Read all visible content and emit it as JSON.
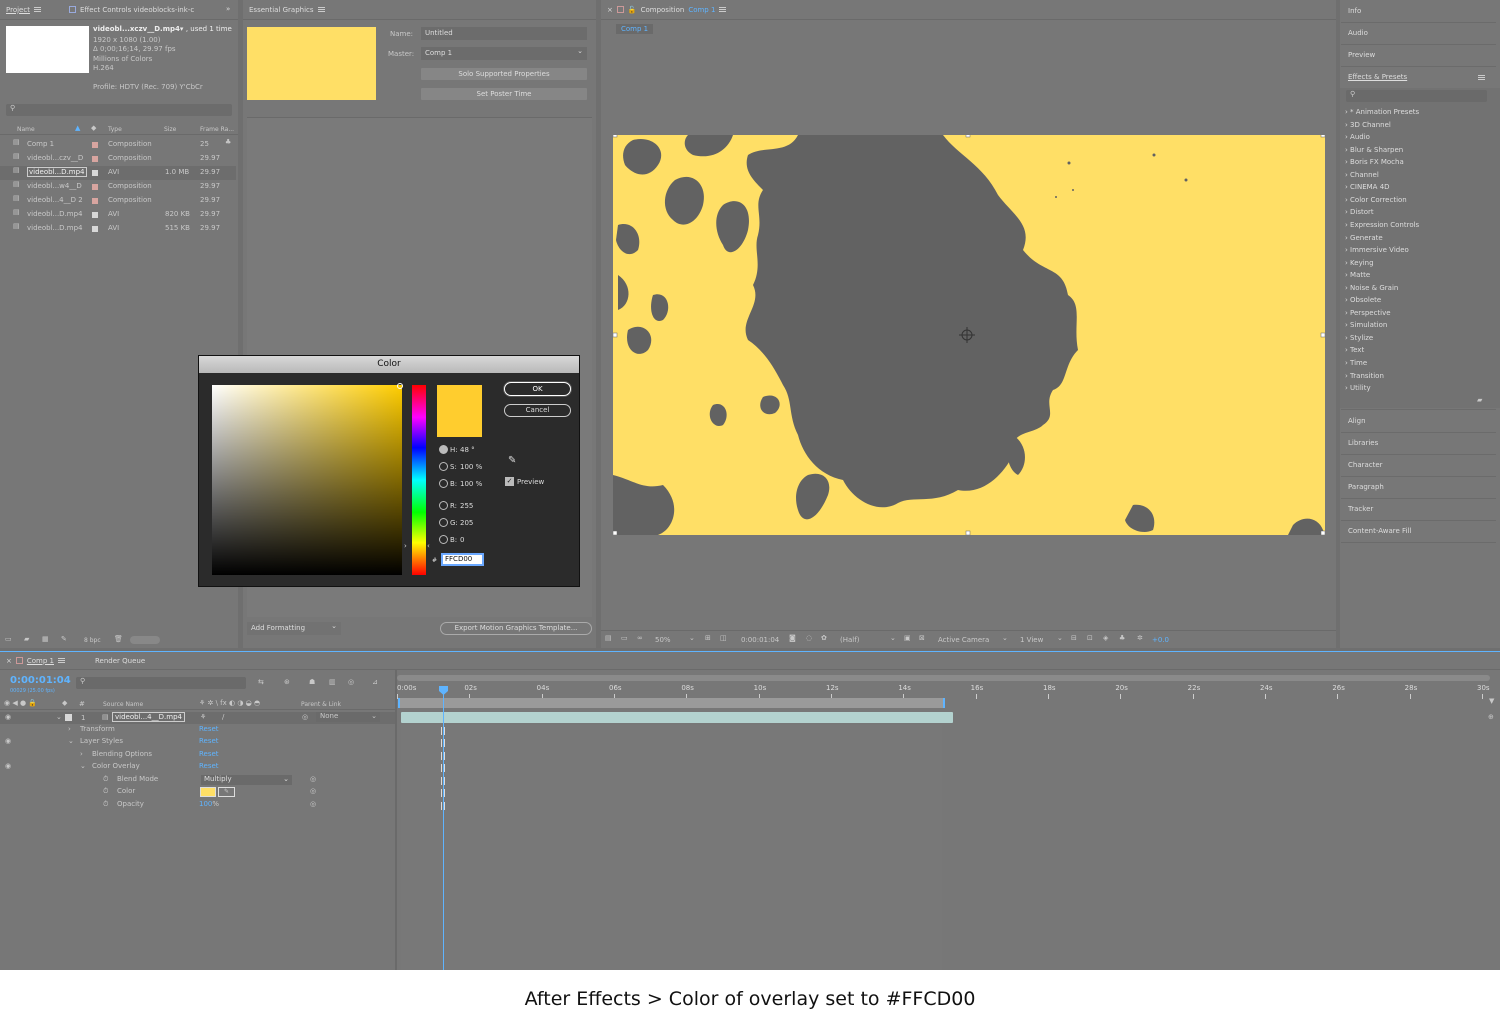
{
  "project": {
    "tab_label": "Project",
    "effect_controls_tab": "Effect Controls videoblocks-ink-c",
    "file_title": "videobl...xczv__D.mp4",
    "used": ", used 1 time",
    "dims": "1920 x 1080 (1.00)",
    "duration": "Δ 0;00;16;14, 29.97 fps",
    "colors": "Millions of Colors",
    "codec": "H.264",
    "profile": "Profile: HDTV (Rec. 709) Y'CbCr",
    "columns": [
      "Name",
      "Type",
      "Size",
      "Frame Ra..."
    ],
    "rows": [
      {
        "name": "Comp 1",
        "type": "Composition",
        "size": "",
        "fps": "25",
        "color": "#d8a5a0"
      },
      {
        "name": "videobl...czv__D",
        "type": "Composition",
        "size": "",
        "fps": "29.97",
        "color": "#d8a5a0"
      },
      {
        "name": "videobl...D.mp4",
        "type": "AVI",
        "size": "1.0 MB",
        "fps": "29.97",
        "color": "#d8d8d8"
      },
      {
        "name": "videobl...w4__D",
        "type": "Composition",
        "size": "",
        "fps": "29.97",
        "color": "#d8a5a0"
      },
      {
        "name": "videobl...4__D 2",
        "type": "Composition",
        "size": "",
        "fps": "29.97",
        "color": "#d8a5a0"
      },
      {
        "name": "videobl...D.mp4",
        "type": "AVI",
        "size": "820 KB",
        "fps": "29.97",
        "color": "#d8d8d8"
      },
      {
        "name": "videobl...D.mp4",
        "type": "AVI",
        "size": "515 KB",
        "fps": "29.97",
        "color": "#d8d8d8"
      }
    ],
    "bpc": "8 bpc"
  },
  "essential": {
    "tab_label": "Essential Graphics",
    "name_label": "Name:",
    "name_value": "Untitled",
    "master_label": "Master:",
    "master_value": "Comp 1",
    "solo_button": "Solo Supported Properties",
    "poster_button": "Set Poster Time",
    "add_formatting": "Add Formatting",
    "export_button": "Export Motion Graphics Template..."
  },
  "composition": {
    "tab_prefix": "Composition",
    "tab_name": "Comp 1",
    "breadcrumb": "Comp 1",
    "zoom": "50%",
    "timecode": "0:00:01:04",
    "resolution": "(Half)",
    "camera": "Active Camera",
    "views": "1 View",
    "exposure": "+0.0",
    "canvas_color": "#ffdf66",
    "ink_color": "#626262"
  },
  "right_panels": {
    "top": [
      "Info",
      "Audio",
      "Preview"
    ],
    "effects_title": "Effects & Presets",
    "effects": [
      "* Animation Presets",
      "3D Channel",
      "Audio",
      "Blur & Sharpen",
      "Boris FX Mocha",
      "Channel",
      "CINEMA 4D",
      "Color Correction",
      "Distort",
      "Expression Controls",
      "Generate",
      "Immersive Video",
      "Keying",
      "Matte",
      "Noise & Grain",
      "Obsolete",
      "Perspective",
      "Simulation",
      "Stylize",
      "Text",
      "Time",
      "Transition",
      "Utility"
    ],
    "bottom": [
      "Align",
      "Libraries",
      "Character",
      "Paragraph",
      "Tracker",
      "Content-Aware Fill"
    ]
  },
  "color_dialog": {
    "title": "Color",
    "ok": "OK",
    "cancel": "Cancel",
    "h_label": "H:",
    "h_value": "48 °",
    "s_label": "S:",
    "s_value": "100 %",
    "b_label": "B:",
    "b_value": "100 %",
    "r_label": "R:",
    "r_value": "255",
    "g_label": "G:",
    "g_value": "205",
    "b2_label": "B:",
    "b2_value": "0",
    "hash": "#",
    "hex": "FFCD00",
    "preview": "Preview",
    "swatch": "#ffcd2e"
  },
  "timeline": {
    "tab_label": "Comp 1",
    "render_queue": "Render Queue",
    "timecode": "0:00:01:04",
    "frames": "00029 (25.00 fps)",
    "col_source": "Source Name",
    "col_parent": "Parent & Link",
    "layer_num": "1",
    "layer_name": "videobl...4__D.mp4",
    "parent_value": "None",
    "props": [
      {
        "label": "Transform",
        "value": "Reset"
      },
      {
        "label": "Layer Styles",
        "value": "Reset"
      },
      {
        "label": "Blending Options",
        "value": "Reset"
      },
      {
        "label": "Color Overlay",
        "value": "Reset"
      }
    ],
    "blend_label": "Blend Mode",
    "blend_value": "Multiply",
    "color_label": "Color",
    "opacity_label": "Opacity",
    "opacity_value": "100",
    "opacity_unit": "%",
    "ruler": [
      "0:00s",
      "02s",
      "04s",
      "06s",
      "08s",
      "10s",
      "12s",
      "14s",
      "16s",
      "18s",
      "20s",
      "22s",
      "24s",
      "26s",
      "28s",
      "30s"
    ]
  },
  "caption": "After Effects > Color of overlay set to #FFCD00"
}
